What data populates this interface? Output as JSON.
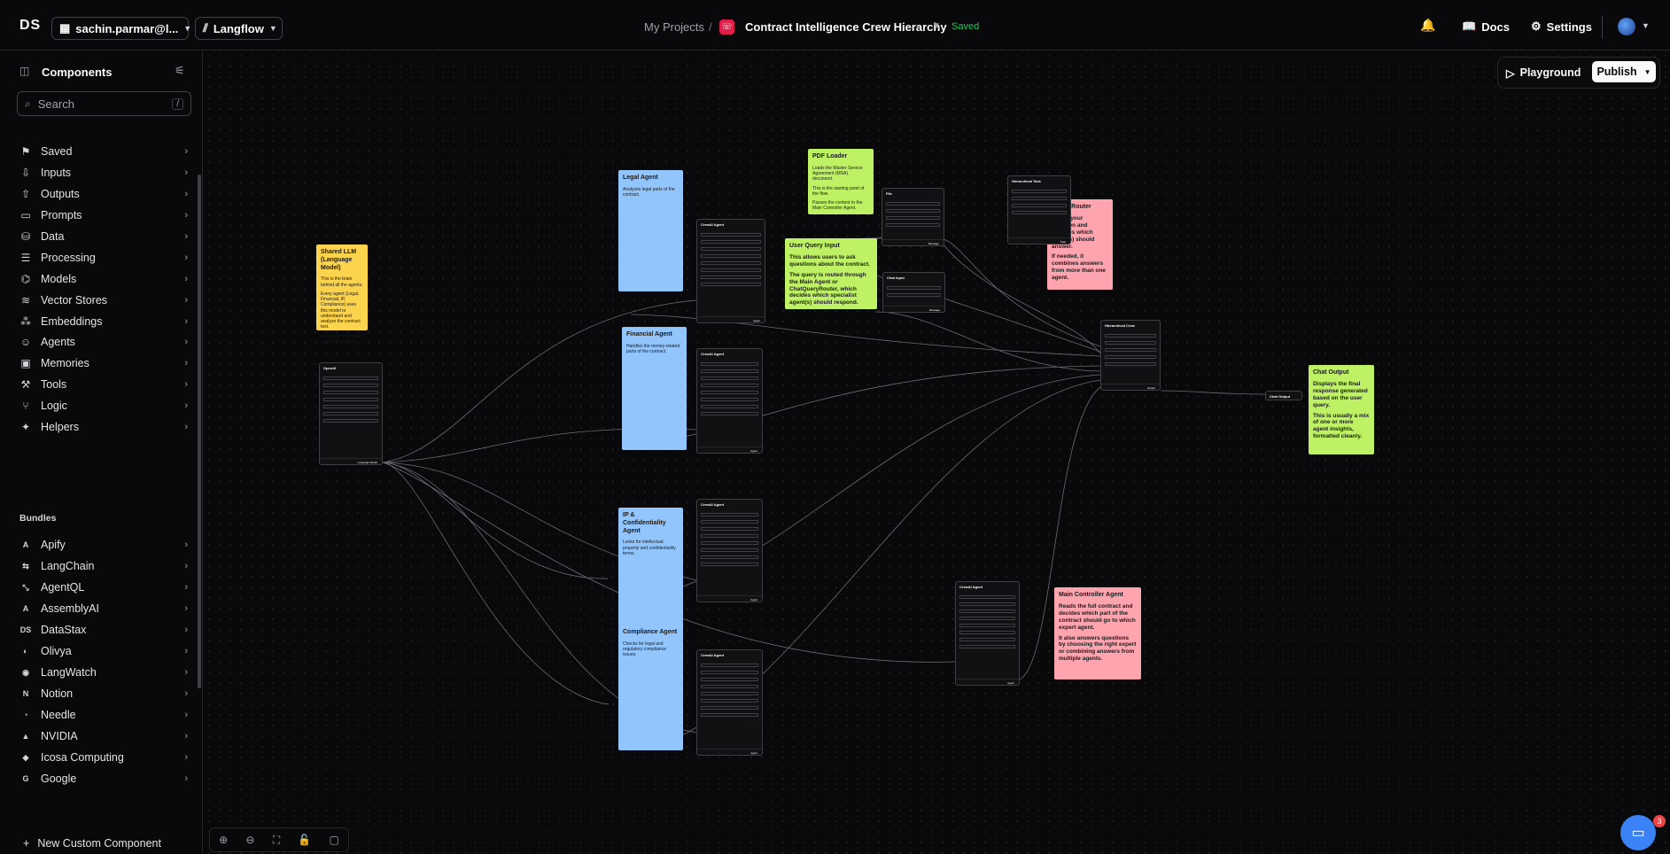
{
  "header": {
    "logo": "DS",
    "account": "sachin.parmar@l...",
    "workspace": "Langflow",
    "breadcrumb_projects": "My Projects",
    "breadcrumb_sep": "/",
    "flow_title": "Contract Intelligence Crew Hierarchy",
    "save_status": "Saved",
    "docs": "Docs",
    "settings": "Settings"
  },
  "sidebar": {
    "title": "Components",
    "search_placeholder": "Search",
    "search_shortcut": "/",
    "items": [
      {
        "label": "Saved",
        "icon": "bookmark-icon"
      },
      {
        "label": "Inputs",
        "icon": "download-icon"
      },
      {
        "label": "Outputs",
        "icon": "upload-icon"
      },
      {
        "label": "Prompts",
        "icon": "terminal-icon"
      },
      {
        "label": "Data",
        "icon": "database-icon"
      },
      {
        "label": "Processing",
        "icon": "list-filter-icon"
      },
      {
        "label": "Models",
        "icon": "brain-icon"
      },
      {
        "label": "Vector Stores",
        "icon": "layers-icon"
      },
      {
        "label": "Embeddings",
        "icon": "binary-icon"
      },
      {
        "label": "Agents",
        "icon": "bot-icon"
      },
      {
        "label": "Memories",
        "icon": "cpu-icon"
      },
      {
        "label": "Tools",
        "icon": "hammer-icon"
      },
      {
        "label": "Logic",
        "icon": "git-branch-icon"
      },
      {
        "label": "Helpers",
        "icon": "wand-icon"
      }
    ],
    "bundles_title": "Bundles",
    "bundles": [
      {
        "label": "Apify"
      },
      {
        "label": "LangChain"
      },
      {
        "label": "AgentQL"
      },
      {
        "label": "AssemblyAI"
      },
      {
        "label": "DataStax"
      },
      {
        "label": "Olivya"
      },
      {
        "label": "LangWatch"
      },
      {
        "label": "Notion"
      },
      {
        "label": "Needle"
      },
      {
        "label": "NVIDIA"
      },
      {
        "label": "Icosa Computing"
      },
      {
        "label": "Google"
      }
    ],
    "new_component": "New Custom Component"
  },
  "canvas": {
    "playground": "Playground",
    "publish": "Publish",
    "badge_count": "3",
    "notes": {
      "shared_llm": {
        "title": "Shared LLM (Language Model)",
        "p1": "This is the brain behind all the agents.",
        "p2": "Every agent (Legal, Financial, IP, Compliance) uses this model to understand and analyze the contract text.",
        "p3": "Make sure to provide your API key here."
      },
      "legal": {
        "title": "Legal Agent",
        "p1": "Analyzes legal parts of the contract."
      },
      "financial": {
        "title": "Financial Agent",
        "p1": "Handles the money-related parts of the contract."
      },
      "ip": {
        "title": "IP & Confidentiality Agent",
        "p1": "Looks for intellectual property and confidentiality terms."
      },
      "compliance": {
        "title": "Compliance Agent",
        "p1": "Checks for legal and regulatory compliance issues."
      },
      "pdf": {
        "title": "PDF Loader",
        "p1": "Loads the Master Service Agreement (MSA) document.",
        "p2": "This is the starting point of the flow.",
        "p3": "Passes the content to the Main Controller Agent."
      },
      "user_query": {
        "title": "User Query Input",
        "p1": "This allows users to ask questions about the contract.",
        "p2": "The query is routed through the Main Agent or ChatQueryRouter, which decides which specialist agent(s) should respond."
      },
      "query_router": {
        "title": "Query Router",
        "p1": "Reads your question and chooses which agent(s) should answer.",
        "p2": "If needed, it combines answers from more than one agent."
      },
      "chat_output": {
        "title": "Chat Output",
        "p1": "Displays the final response generated based on the user query.",
        "p2": "This is usually a mix of one or more agent insights, formatted cleanly."
      },
      "main_controller": {
        "title": "Main Controller Agent",
        "p1": "Reads the full contract and decides which part of the contract should go to which expert agent.",
        "p2": "It also answers questions by choosing the right expert or combining answers from multiple agents."
      }
    },
    "nodes": {
      "openai": "OpenAI",
      "crewai": "CrewAI Agent",
      "file": "File",
      "hier_task": "Hierarchical Task",
      "hier_crew": "Hierarchical Crew",
      "chat_input": "Chat Input",
      "chat_output": "Chat Output",
      "out_agent": "Agent",
      "out_message": "Message",
      "out_lm": "Language Model",
      "out_task": "Task",
      "out_output": "Output"
    }
  }
}
